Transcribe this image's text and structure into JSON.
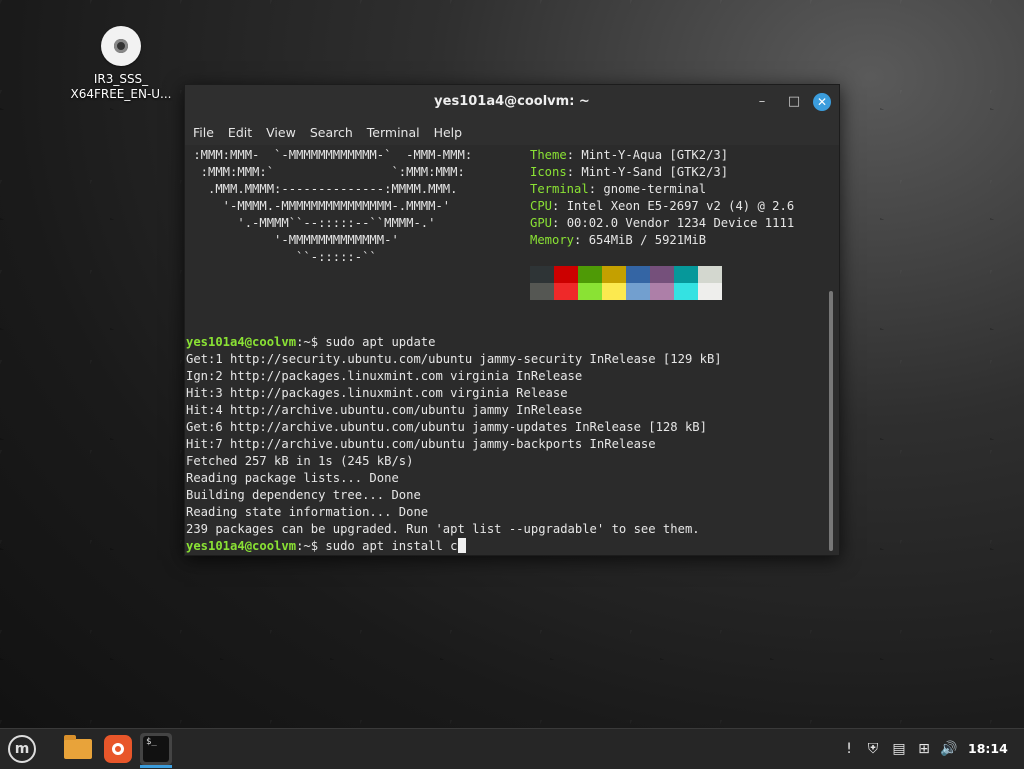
{
  "desktop": {
    "icon_label_line1": "IR3_SSS_",
    "icon_label_line2": "X64FREE_EN-U..."
  },
  "window": {
    "title": "yes101a4@coolvm: ~",
    "min_glyph": "–",
    "max_glyph": "□",
    "close_glyph": "✕",
    "menu": [
      "File",
      "Edit",
      "View",
      "Search",
      "Terminal",
      "Help"
    ]
  },
  "neofetch": {
    "art": [
      " :MMM:MMM-  `-MMMMMMMMMMMM-`  -MMM-MMM:",
      "  :MMM:MMM:`                `:MMM:MMM:",
      "   .MMM.MMMM:--------------:MMMM.MMM.",
      "     '-MMMM.-MMMMMMMMMMMMMMM-.MMMM-'",
      "       '.-MMMM``--:::::--``MMMM-.'",
      "            '-MMMMMMMMMMMMM-'",
      "               ``-:::::-``"
    ],
    "info": [
      {
        "key": "Theme",
        "value": ": Mint-Y-Aqua [GTK2/3]"
      },
      {
        "key": "Icons",
        "value": ": Mint-Y-Sand [GTK2/3]"
      },
      {
        "key": "Terminal",
        "value": ": gnome-terminal"
      },
      {
        "key": "CPU",
        "value": ": Intel Xeon E5-2697 v2 (4) @ 2.6"
      },
      {
        "key": "GPU",
        "value": ": 00:02.0 Vendor 1234 Device 1111"
      },
      {
        "key": "Memory",
        "value": ": 654MiB / 5921MiB"
      }
    ],
    "palette_colors": [
      "#2e3436",
      "#cc0000",
      "#4e9a06",
      "#c4a000",
      "#3465a4",
      "#75507b",
      "#06989a",
      "#d3d7cf",
      "#555753",
      "#ef2929",
      "#8ae234",
      "#fce94f",
      "#729fcf",
      "#ad7fa8",
      "#34e2e2",
      "#eeeeec"
    ]
  },
  "terminal": {
    "prompt": "yes101a4@coolvm",
    "prompt_suffix": ":~$ ",
    "cmd1": "sudo apt update",
    "output": [
      "Get:1 http://security.ubuntu.com/ubuntu jammy-security InRelease [129 kB]",
      "Ign:2 http://packages.linuxmint.com virginia InRelease",
      "Hit:3 http://packages.linuxmint.com virginia Release",
      "Hit:4 http://archive.ubuntu.com/ubuntu jammy InRelease",
      "Get:6 http://archive.ubuntu.com/ubuntu jammy-updates InRelease [128 kB]",
      "Hit:7 http://archive.ubuntu.com/ubuntu jammy-backports InRelease",
      "Fetched 257 kB in 1s (245 kB/s)",
      "Reading package lists... Done",
      "Building dependency tree... Done",
      "Reading state information... Done",
      "239 packages can be upgraded. Run 'apt list --upgradable' to see them."
    ],
    "cmd2": "sudo apt install c"
  },
  "taskbar": {
    "mint_glyph": "m",
    "terminal_glyph": "$_",
    "tray": {
      "updates_glyph": "!",
      "shield_glyph": "⛨",
      "clipboard_glyph": "▤",
      "network_glyph": "⊞",
      "volume_glyph": "🔊"
    },
    "clock": "18:14"
  }
}
